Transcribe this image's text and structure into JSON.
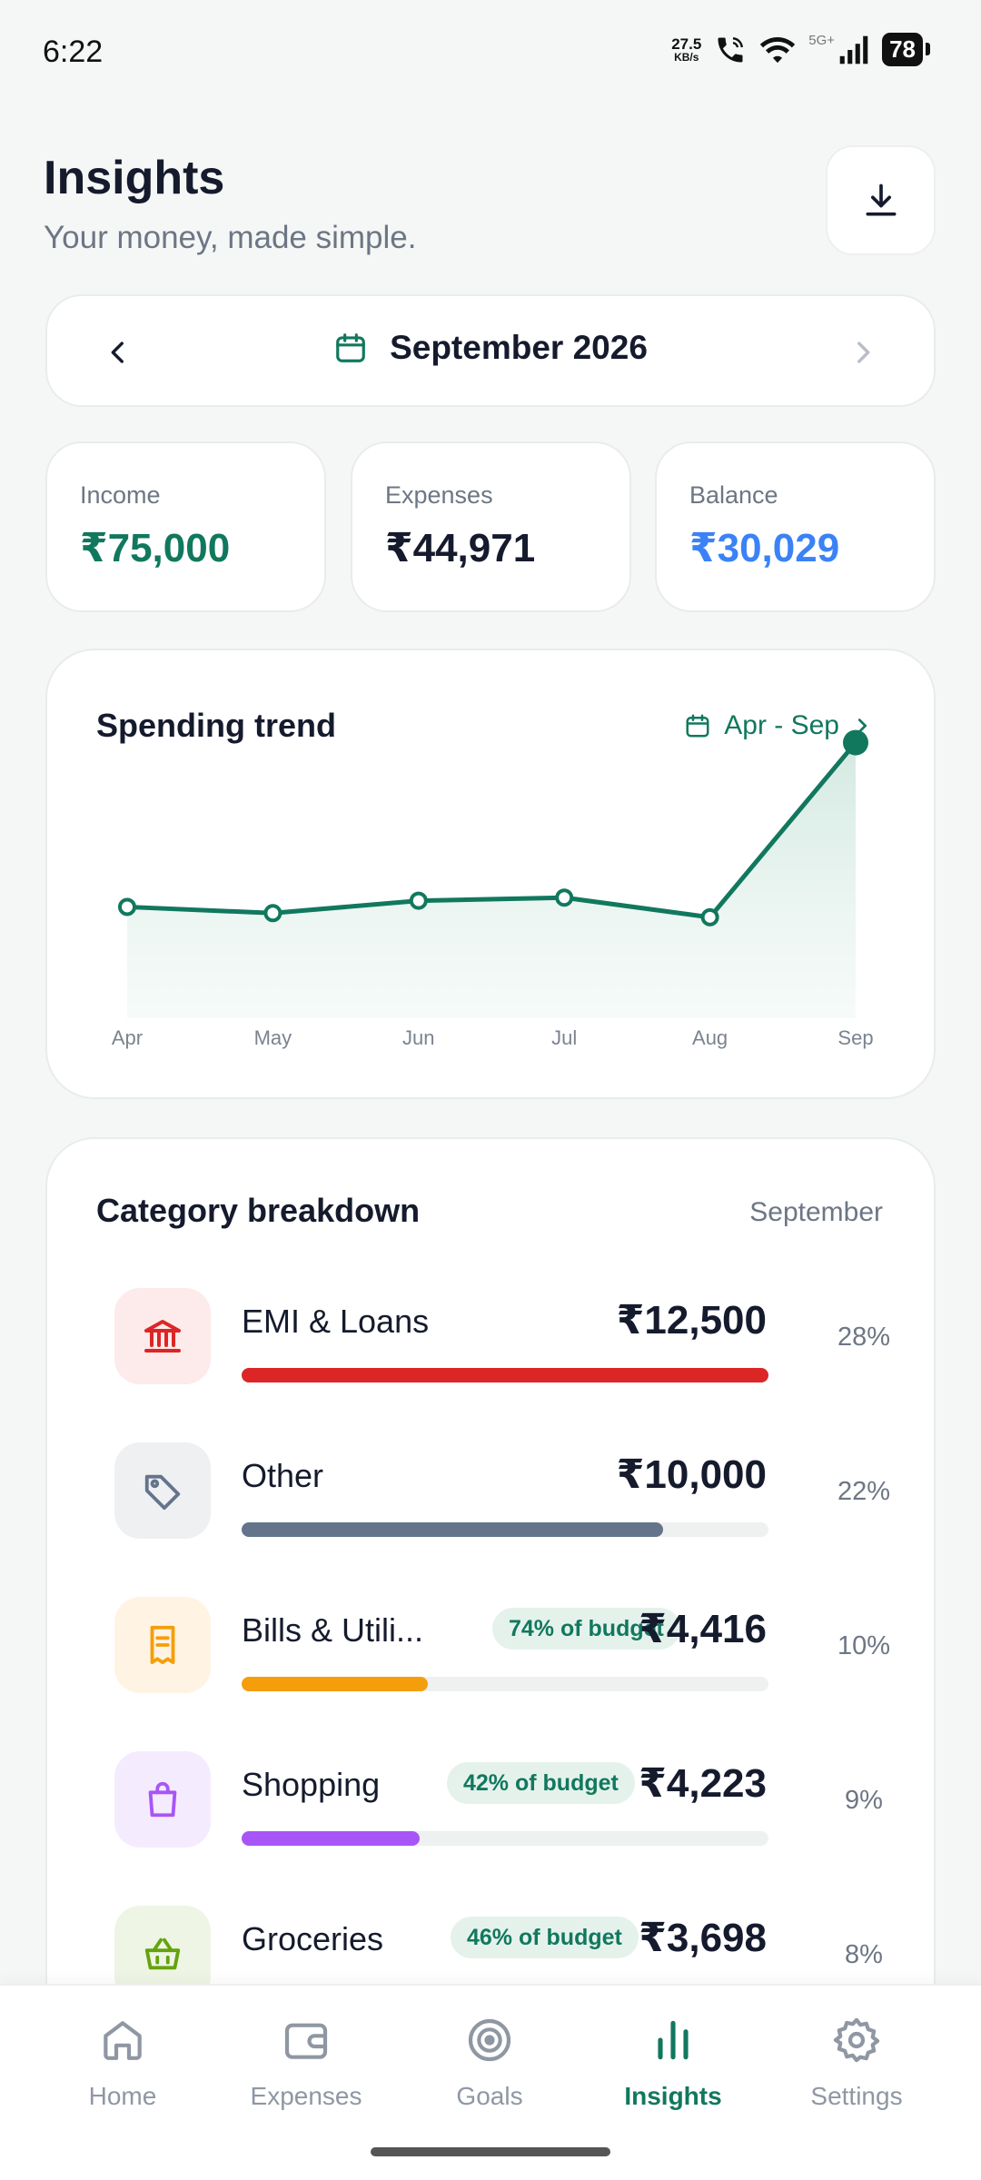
{
  "status_bar": {
    "time": "6:22",
    "net_speed_value": "27.5",
    "net_speed_unit": "KB/s",
    "signal_label": "5G+",
    "battery": "78"
  },
  "header": {
    "title": "Insights",
    "subtitle": "Your money, made simple."
  },
  "month_selector": {
    "label": "September 2026"
  },
  "stats": [
    {
      "label": "Income",
      "value": "₹75,000",
      "color": "#11785e"
    },
    {
      "label": "Expenses",
      "value": "₹44,971",
      "color": "#151b2d"
    },
    {
      "label": "Balance",
      "value": "₹30,029",
      "color": "#3b82f6"
    }
  ],
  "trend": {
    "title": "Spending trend",
    "range_label": "Apr - Sep"
  },
  "chart_data": {
    "type": "area",
    "categories": [
      "Apr",
      "May",
      "Jun",
      "Jul",
      "Aug",
      "Sep"
    ],
    "values": [
      5500,
      4900,
      6100,
      6400,
      4500,
      21400
    ],
    "note": "approximate values read from relative line position; no y-axis shown",
    "line_color": "#11785e",
    "fill_color": "#dcefe8",
    "grid": false,
    "legend": "none"
  },
  "categories": {
    "title": "Category breakdown",
    "month_label": "September",
    "items": [
      {
        "name": "EMI & Loans",
        "amount": "₹12,500",
        "percent": "28%",
        "badge": "",
        "fill_fraction": 1.0,
        "color": "#dc2626",
        "icon_bg": "#fdeaea",
        "icon": "bank-icon"
      },
      {
        "name": "Other",
        "amount": "₹10,000",
        "percent": "22%",
        "badge": "",
        "fill_fraction": 0.8,
        "color": "#64748b",
        "icon_bg": "#eef0f2",
        "icon": "tag-icon"
      },
      {
        "name": "Bills & Utili...",
        "amount": "₹4,416",
        "percent": "10%",
        "badge": "74% of budget",
        "fill_fraction": 0.353,
        "color": "#f59e0b",
        "icon_bg": "#fff4e3",
        "icon": "receipt-icon"
      },
      {
        "name": "Shopping",
        "amount": "₹4,223",
        "percent": "9%",
        "badge": "42% of budget",
        "fill_fraction": 0.338,
        "color": "#a855f7",
        "icon_bg": "#f5ebfe",
        "icon": "shopping-bag-icon"
      },
      {
        "name": "Groceries",
        "amount": "₹3,698",
        "percent": "8%",
        "badge": "46% of budget",
        "fill_fraction": 0.296,
        "color": "#65a30d",
        "icon_bg": "#eef5e4",
        "icon": "basket-icon"
      }
    ]
  },
  "nav": {
    "items": [
      {
        "label": "Home",
        "icon": "home-icon",
        "active": false
      },
      {
        "label": "Expenses",
        "icon": "wallet-icon",
        "active": false
      },
      {
        "label": "Goals",
        "icon": "target-icon",
        "active": false
      },
      {
        "label": "Insights",
        "icon": "bar-chart-icon",
        "active": true
      },
      {
        "label": "Settings",
        "icon": "gear-icon",
        "active": false
      }
    ]
  },
  "colors": {
    "accent": "#11785e",
    "text": "#151b2d",
    "muted": "#6d7684",
    "background": "#f5f7f6"
  }
}
